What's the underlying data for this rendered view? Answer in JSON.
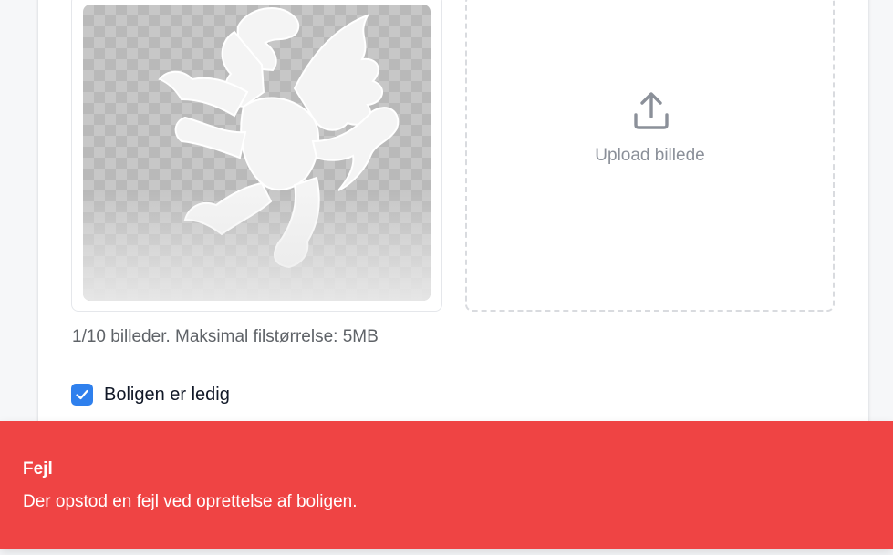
{
  "upload": {
    "label": "Upload billede",
    "icon": "upload-icon"
  },
  "images": {
    "preview_icon": "heraldic-lion-image",
    "hint": "1/10 billeder. Maksimal filstørrelse: 5MB"
  },
  "availability": {
    "checked": true,
    "label": "Boligen er ledig"
  },
  "toast": {
    "title": "Fejl",
    "message": "Der opstod en fejl ved oprettelse af boligen.",
    "color": "#ef4444"
  },
  "colors": {
    "checkbox": "#2f80ed",
    "toast_bg": "#ef4444"
  }
}
